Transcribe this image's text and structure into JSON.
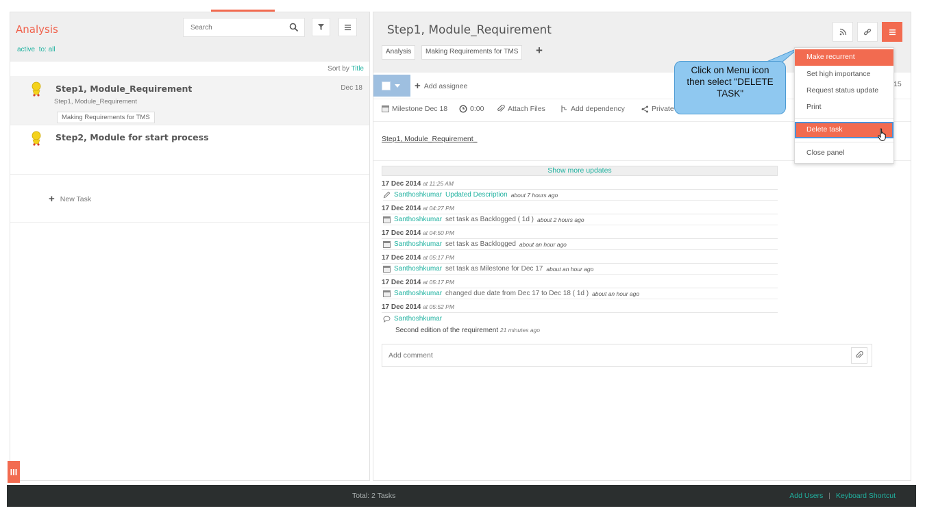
{
  "left_panel": {
    "folder_title": "Analysis",
    "filter_active": "active",
    "filter_to": "to: all",
    "search_placeholder": "Search",
    "sort_label": "Sort by",
    "sort_value": "Title",
    "tasks": [
      {
        "title": "Step1, Module_Requirement",
        "subtitle": "Step1, Module_Requirement",
        "tag": "Making Requirements for TMS",
        "date": "Dec 18"
      },
      {
        "title": "Step2, Module for start process"
      }
    ],
    "new_task_label": "New Task",
    "panel_toggle_glyph": "III"
  },
  "detail": {
    "title": "Step1, Module_Requirement",
    "breadcrumbs": [
      "Analysis",
      "Making Requirements for TMS"
    ],
    "add_assignee": "Add assignee",
    "trailing_number": "15",
    "meta": {
      "milestone": "Milestone Dec 18",
      "time": "0:00",
      "attach": "Attach Files",
      "dependency": "Add dependency",
      "privacy": "Private"
    },
    "description": "Step1, Module_Requirement_",
    "show_more": "Show more updates",
    "updates": [
      {
        "date": "17 Dec 2014",
        "time": "at 11:25 AM",
        "user": "Santhoshkumar",
        "action": "Updated Description",
        "ago": "about 7 hours ago"
      },
      {
        "date": "17 Dec 2014",
        "time": "at 04:27 PM",
        "user": "Santhoshkumar",
        "action": "set task as Backlogged ( 1d )",
        "ago": "about 2 hours ago"
      },
      {
        "date": "17 Dec 2014",
        "time": "at 04:50 PM",
        "user": "Santhoshkumar",
        "action": "set task as Backlogged",
        "ago": "about an hour ago"
      },
      {
        "date": "17 Dec 2014",
        "time": "at 05:17 PM",
        "user": "Santhoshkumar",
        "action": "set task as Milestone for Dec 17",
        "ago": "about an hour ago"
      },
      {
        "date": "17 Dec 2014",
        "time": "at 05:17 PM",
        "user": "Santhoshkumar",
        "action": "changed due date from Dec 17 to Dec 18 ( 1d )",
        "ago": "about an hour ago"
      },
      {
        "date": "17 Dec 2014",
        "time": "at 05:52 PM",
        "user": "Santhoshkumar",
        "comment": "Second edition of the requirement",
        "ago": "21 minutes ago"
      }
    ],
    "comment_placeholder": "Add comment"
  },
  "menu": {
    "items": [
      "Make recurrent",
      "Set high importance",
      "Request status update",
      "Print",
      "Delete task",
      "Close panel"
    ],
    "highlighted": "Make recurrent",
    "selected": "Delete task"
  },
  "callout": {
    "line1": "Click on Menu icon",
    "line2": "then select \"DELETE",
    "line3": "TASK\""
  },
  "footer": {
    "total": "Total: 2 Tasks",
    "add_users": "Add Users",
    "separator": "|",
    "shortcuts": "Keyboard Shortcut"
  },
  "colors": {
    "accent": "#f26b50",
    "link": "#20b2a0",
    "callout": "#8fc8f0",
    "footer": "#2b2f2f"
  },
  "icons": [
    "search-icon",
    "filter-icon",
    "list-menu-icon",
    "rss-icon",
    "link-icon",
    "hamburger-icon",
    "plus-icon",
    "calendar-icon",
    "clock-icon",
    "paperclip-icon",
    "dependency-icon",
    "share-icon",
    "pencil-icon",
    "comment-icon",
    "hand-cursor-icon"
  ]
}
